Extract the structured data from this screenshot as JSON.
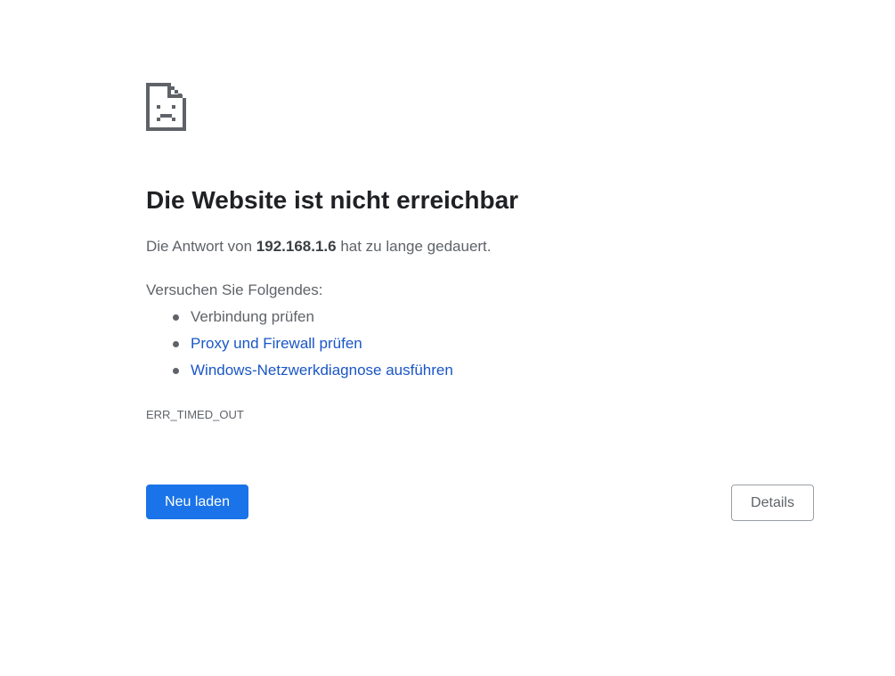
{
  "error_page": {
    "icon": "sad-page-icon",
    "title": "Die Website ist nicht erreichbar",
    "summary": {
      "prefix": "Die Antwort von ",
      "host": "192.168.1.6",
      "suffix": " hat zu lange gedauert."
    },
    "suggestions": {
      "heading": "Versuchen Sie Folgendes:",
      "items": [
        {
          "label": "Verbindung prüfen",
          "is_link": false
        },
        {
          "label": "Proxy und Firewall prüfen",
          "is_link": true
        },
        {
          "label": "Windows-Netzwerkdiagnose ausführen",
          "is_link": true
        }
      ]
    },
    "error_code": "ERR_TIMED_OUT",
    "buttons": {
      "reload_label": "Neu laden",
      "details_label": "Details"
    },
    "colors": {
      "primary_button": "#1a73e8",
      "link": "#1a56c5",
      "title_text": "#202124",
      "body_text": "#5f6368",
      "icon": "#5f6368"
    }
  }
}
